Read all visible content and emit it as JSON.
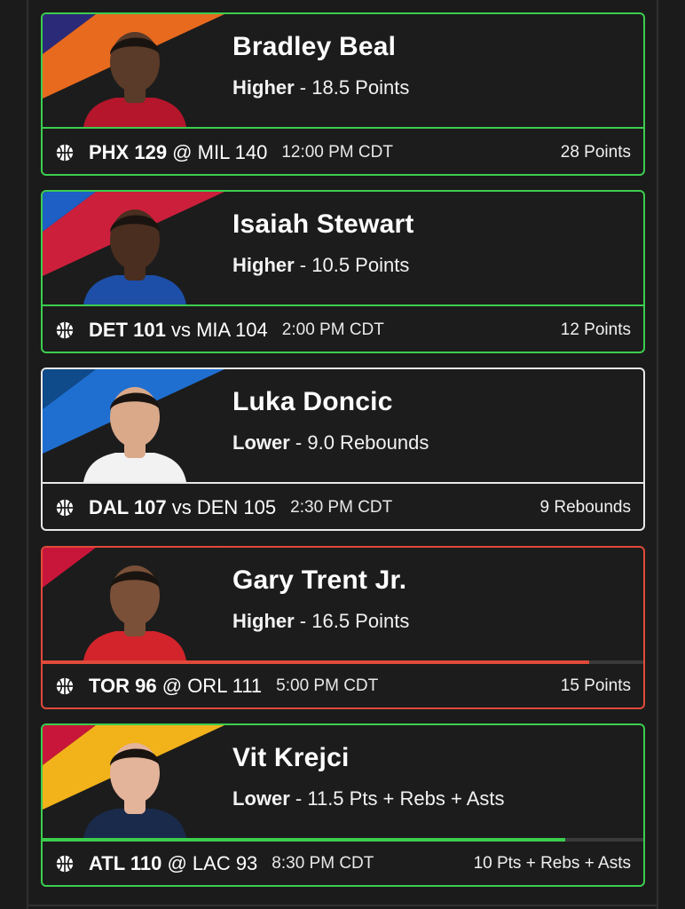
{
  "picks": [
    {
      "player": "Bradley Beal",
      "direction": "Higher",
      "separator": " - ",
      "line": "18.5 Points",
      "team1": "PHX 129",
      "connector": " @ ",
      "team2": "MIL 140",
      "time": "12:00 PM CDT",
      "result": "28 Points",
      "status": "win",
      "stripe_colors": [
        "#2b2a78",
        "#e86a1f"
      ],
      "jersey_color": "#b5162c",
      "skin_color": "#5a3a28"
    },
    {
      "player": "Isaiah Stewart",
      "direction": "Higher",
      "separator": " - ",
      "line": "10.5 Points",
      "team1": "DET 101",
      "connector": " vs ",
      "team2": "MIA 104",
      "time": "2:00 PM CDT",
      "result": "12 Points",
      "status": "win",
      "stripe_colors": [
        "#1d5fc4",
        "#cc1f3b"
      ],
      "jersey_color": "#1d4fa8",
      "skin_color": "#4a2e20"
    },
    {
      "player": "Luka Doncic",
      "direction": "Lower",
      "separator": " - ",
      "line": "9.0 Rebounds",
      "team1": "DAL 107",
      "connector": " vs ",
      "team2": "DEN 105",
      "time": "2:30 PM CDT",
      "result": "9 Rebounds",
      "status": "push",
      "stripe_colors": [
        "#0f4a8a",
        "#1f6fd1"
      ],
      "jersey_color": "#f2f2f2",
      "skin_color": "#d9a98a"
    },
    {
      "player": "Gary Trent Jr.",
      "direction": "Higher",
      "separator": " - ",
      "line": "16.5 Points",
      "team1": "TOR 96",
      "connector": " @ ",
      "team2": "ORL 111",
      "time": "5:00 PM CDT",
      "result": "15 Points",
      "status": "loss",
      "progress": 0.91,
      "progress_color": "#e04a3a",
      "stripe_colors": [
        "#c8163a",
        "#1c1c1c"
      ],
      "jersey_color": "#d3242b",
      "skin_color": "#7a5038"
    },
    {
      "player": "Vit Krejci",
      "direction": "Lower",
      "separator": " - ",
      "line": "11.5 Pts + Rebs + Asts",
      "team1": "ATL 110",
      "connector": " @ ",
      "team2": "LAC 93",
      "time": "8:30 PM CDT",
      "result": "10 Pts + Rebs + Asts",
      "status": "win",
      "progress": 0.87,
      "progress_color": "#3ccd4e",
      "stripe_colors": [
        "#c8163a",
        "#f2b21a"
      ],
      "jersey_color": "#1a2a4a",
      "skin_color": "#e3b39a"
    }
  ]
}
